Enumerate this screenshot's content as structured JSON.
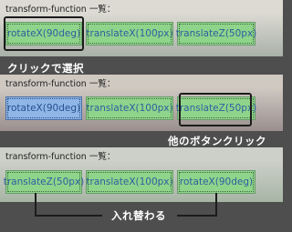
{
  "panels": [
    {
      "title": "transform-function 一覧：",
      "buttons": [
        "rotateX(90deg)",
        "translateX(100px)",
        "translateZ(50px)"
      ],
      "selected_index": 0
    },
    {
      "title": "transform-function 一覧：",
      "buttons": [
        "rotateX(90deg)",
        "translateX(100px)",
        "translateZ(50px)"
      ],
      "selected_index": 0
    },
    {
      "title": "transform-function 一覧：",
      "buttons": [
        "translateZ(50px)",
        "translateX(100px)",
        "rotateX(90deg)"
      ],
      "selected_index": null
    }
  ],
  "captions": {
    "step1": "クリックで選択",
    "step2": "他のボタンクリック",
    "step3": "入れ替わる"
  },
  "colors": {
    "button_green": "#8fd48b",
    "button_selected_blue": "#8fb6e6",
    "button_text": "#2f5fa0",
    "caption_text": "#ffffff",
    "background": "#4e4e4e"
  }
}
